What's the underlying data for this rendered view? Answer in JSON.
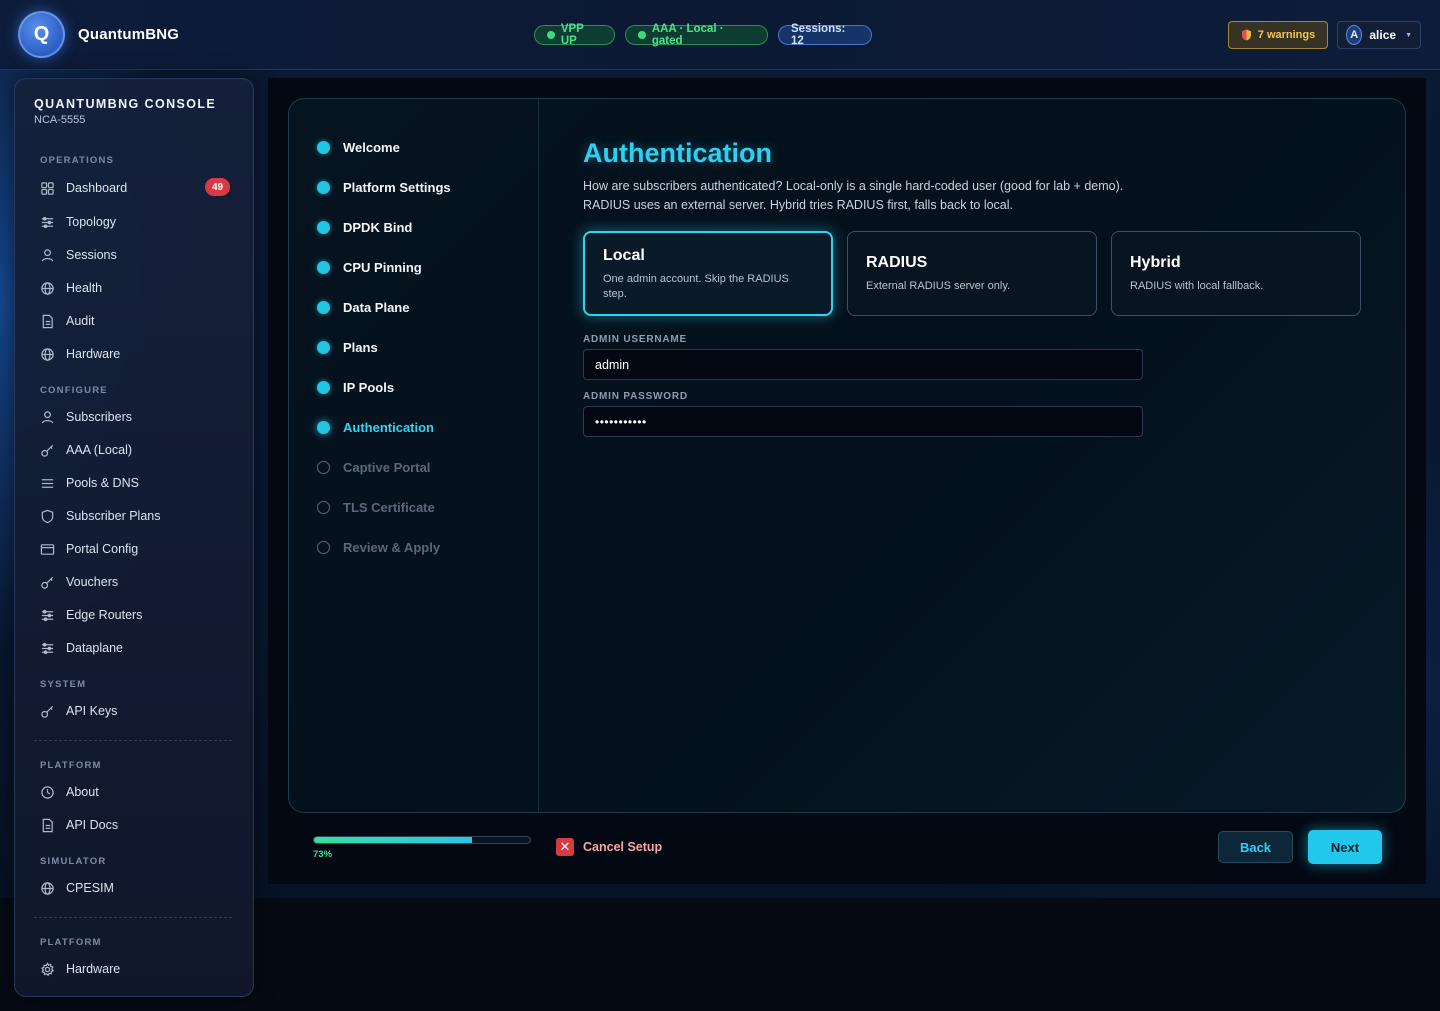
{
  "app": {
    "logo_letter": "Q",
    "brand": "QuantumBNG"
  },
  "status": {
    "vpp": "VPP UP",
    "aaa": "AAA · Local · gated",
    "sessions": "Sessions: 12",
    "warnings": "7 warnings",
    "user_initial": "A",
    "user_name": "alice"
  },
  "sidebar": {
    "title": "QUANTUMBNG CONSOLE",
    "subtitle": "NCA-5555",
    "sections": {
      "operations": "OPERATIONS",
      "configure": "CONFIGURE",
      "system": "SYSTEM",
      "platform1": "PLATFORM",
      "simulator": "SIMULATOR",
      "platform2": "PLATFORM"
    },
    "items": {
      "dashboard": "Dashboard",
      "dashboard_badge": "49",
      "topology": "Topology",
      "sessions": "Sessions",
      "health": "Health",
      "audit": "Audit",
      "hardware": "Hardware",
      "subscribers": "Subscribers",
      "aaa_local": "AAA (Local)",
      "pools_dns": "Pools & DNS",
      "subscriber_plans": "Subscriber Plans",
      "portal_config": "Portal Config",
      "vouchers": "Vouchers",
      "edge_routers": "Edge Routers",
      "dataplane": "Dataplane",
      "api_keys": "API Keys",
      "about": "About",
      "api_docs": "API Docs",
      "cpesim": "CPESIM",
      "hardware2": "Hardware"
    }
  },
  "wizard": {
    "steps": [
      {
        "label": "Welcome",
        "state": "done"
      },
      {
        "label": "Platform Settings",
        "state": "done"
      },
      {
        "label": "DPDK Bind",
        "state": "done"
      },
      {
        "label": "CPU Pinning",
        "state": "done"
      },
      {
        "label": "Data Plane",
        "state": "done"
      },
      {
        "label": "Plans",
        "state": "done"
      },
      {
        "label": "IP Pools",
        "state": "done"
      },
      {
        "label": "Authentication",
        "state": "active"
      },
      {
        "label": "Captive Portal",
        "state": "pending"
      },
      {
        "label": "TLS Certificate",
        "state": "pending"
      },
      {
        "label": "Review & Apply",
        "state": "pending"
      }
    ],
    "heading": "Authentication",
    "description_line1": "How are subscribers authenticated? Local-only is a single hard-coded user (good for lab + demo).",
    "description_line2": "RADIUS uses an external server. Hybrid tries RADIUS first, falls back to local.",
    "options": {
      "local": {
        "title": "Local",
        "desc": "One admin account. Skip the RADIUS step."
      },
      "radius": {
        "title": "RADIUS",
        "desc": "External RADIUS server only."
      },
      "hybrid": {
        "title": "Hybrid",
        "desc": "RADIUS with local fallback."
      }
    },
    "selected_option": "local",
    "username_label": "ADMIN USERNAME",
    "username_value": "admin",
    "password_label": "ADMIN PASSWORD",
    "password_value": "•••••••••••",
    "progress_percent": 73,
    "progress_text": "73%",
    "cancel_label": "Cancel Setup",
    "back_label": "Back",
    "next_label": "Next"
  },
  "colors": {
    "accent": "#22c8ec",
    "success": "#3ddc7a",
    "danger": "#d83a45",
    "warning": "#f5c451"
  }
}
